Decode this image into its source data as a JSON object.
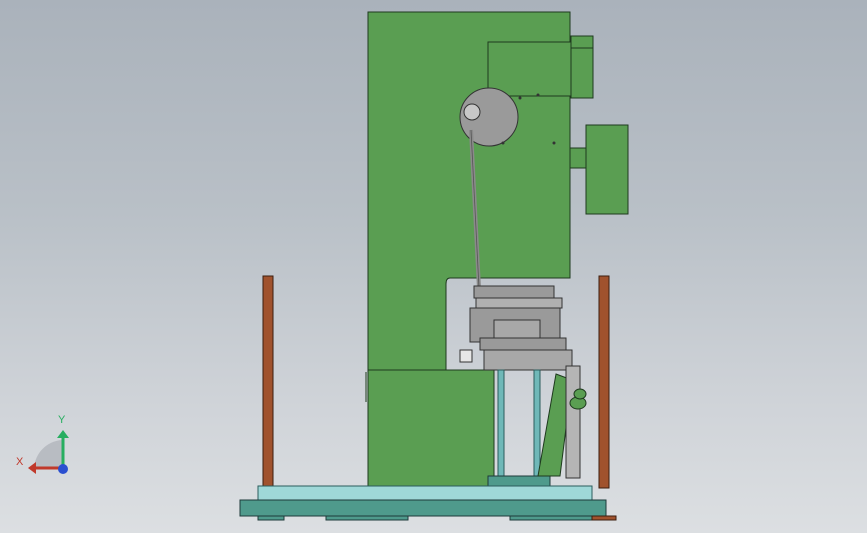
{
  "viewport": {
    "background_top": "#aab2bb",
    "background_bottom": "#dcdfe2"
  },
  "model": {
    "frame_color": "#5a9e52",
    "frame_outline": "#1e3a1e",
    "post_color": "#a0522d",
    "rail_color": "#9fd8d8",
    "base_color": "#4f9a8c",
    "mechanism_color": "#9a9a9a"
  },
  "triad": {
    "x_label": "X",
    "y_label": "Y",
    "x_color": "#c0392b",
    "y_color": "#27ae60",
    "z_color": "#2a4fd0"
  }
}
